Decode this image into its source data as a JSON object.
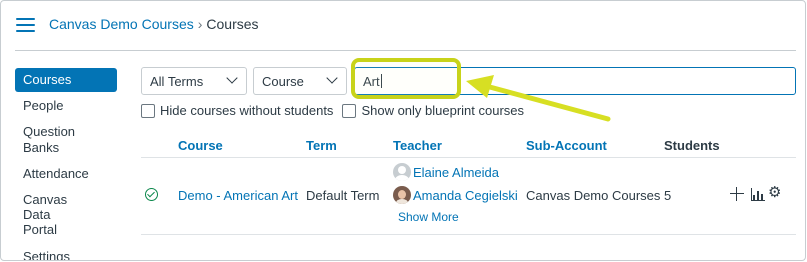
{
  "breadcrumb": {
    "root": "Canvas Demo Courses",
    "separator": "›",
    "current": "Courses"
  },
  "sidebar": {
    "items": [
      {
        "label": "Courses",
        "active": true
      },
      {
        "label": "People"
      },
      {
        "label": "Question Banks"
      },
      {
        "label": "Attendance"
      },
      {
        "label": "Canvas Data Portal"
      },
      {
        "label": "Settings"
      }
    ]
  },
  "filters": {
    "term": "All Terms",
    "search_by": "Course",
    "search_value": "Art"
  },
  "options": {
    "hide_without_students": "Hide courses without students",
    "show_blueprint": "Show only blueprint courses"
  },
  "table": {
    "headers": {
      "course": "Course",
      "term": "Term",
      "teacher": "Teacher",
      "sub_account": "Sub-Account",
      "students": "Students"
    },
    "rows": [
      {
        "course": "Demo - American Art",
        "term": "Default Term",
        "teachers": [
          "Elaine Almeida",
          "Amanda Cegielski"
        ],
        "show_more": "Show More",
        "sub_account": "Canvas Demo Courses",
        "students": "5"
      }
    ]
  },
  "colors": {
    "link": "#0374b5",
    "highlight": "#c8d31a",
    "arrow": "#d7df23",
    "status": "#0b874b"
  }
}
